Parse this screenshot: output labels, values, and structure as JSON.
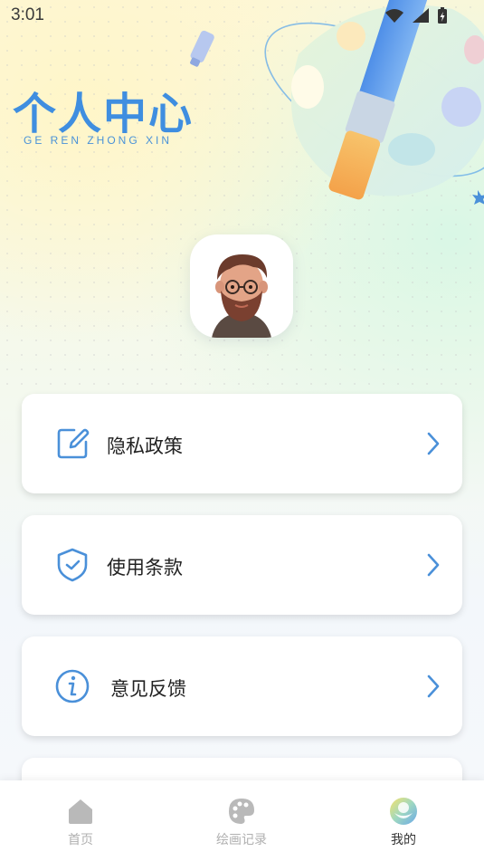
{
  "status_bar": {
    "time": "3:01"
  },
  "header": {
    "title": "个人中心",
    "subtitle": "GE REN ZHONG XIN"
  },
  "menu": {
    "items": [
      {
        "label": "隐私政策",
        "icon": "edit-icon"
      },
      {
        "label": "使用条款",
        "icon": "shield-check-icon"
      },
      {
        "label": "意见反馈",
        "icon": "info-icon"
      }
    ]
  },
  "tabbar": {
    "tabs": [
      {
        "label": "首页",
        "icon": "home-icon",
        "active": false
      },
      {
        "label": "绘画记录",
        "icon": "palette-icon",
        "active": false
      },
      {
        "label": "我的",
        "icon": "profile-icon",
        "active": true
      }
    ]
  },
  "colors": {
    "accent": "#3f8ee0",
    "icon_blue": "#4a90d9",
    "tab_inactive": "#b0b0b0"
  }
}
